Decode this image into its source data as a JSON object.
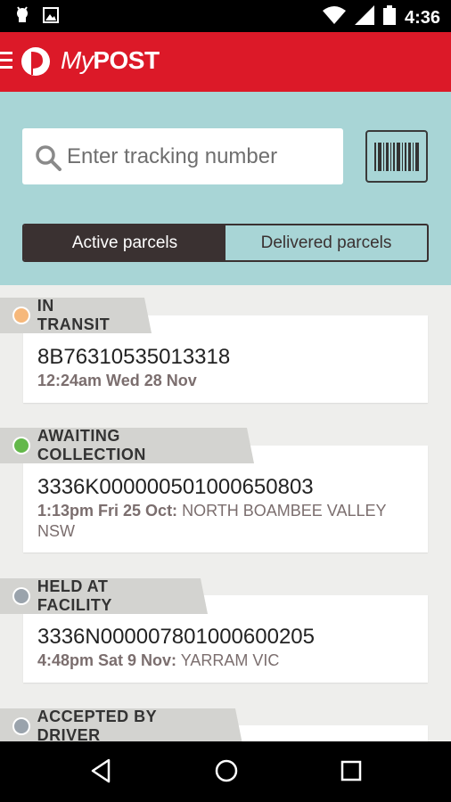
{
  "statusbar": {
    "time": "4:36",
    "icons": [
      "android-icon",
      "image-icon",
      "wifi-icon",
      "signal-icon",
      "battery-icon"
    ]
  },
  "appbar": {
    "brand_my": "My",
    "brand_post": "POST",
    "accent": "#dc1928"
  },
  "search": {
    "placeholder": "Enter tracking number",
    "value": ""
  },
  "tabs": [
    {
      "label": "Active parcels",
      "active": true
    },
    {
      "label": "Delivered parcels",
      "active": false
    }
  ],
  "parcels": [
    {
      "status": "IN TRANSIT",
      "status_color": "#f6b87b",
      "tracking": "8B76310535013318",
      "when": "12:24am Wed 28 Nov",
      "where": ""
    },
    {
      "status": "AWAITING COLLECTION",
      "status_color": "#63b84a",
      "tracking": "3336K000000501000650803",
      "when": "1:13pm Fri 25 Oct:",
      "where": "NORTH BOAMBEE VALLEY NSW"
    },
    {
      "status": "HELD AT FACILITY",
      "status_color": "#9aa3ac",
      "tracking": "3336N000007801000600205",
      "when": "4:48pm Sat 9 Nov:",
      "where": "YARRAM VIC"
    },
    {
      "status": "ACCEPTED BY DRIVER",
      "status_color": "#9aa3ac",
      "tracking": "",
      "when": "",
      "where": ""
    }
  ]
}
